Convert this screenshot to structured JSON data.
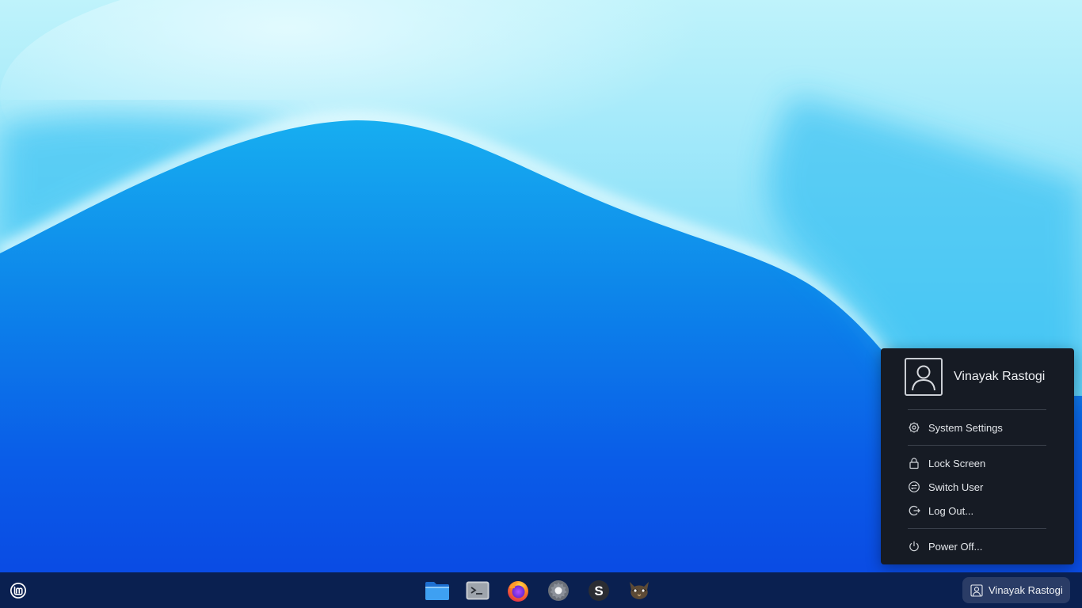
{
  "desktop": {
    "accent": "#0a52e8"
  },
  "user_menu": {
    "username": "Vinayak Rastogi",
    "avatar_icon": "user-avatar-icon",
    "items": [
      {
        "label": "System Settings",
        "icon": "gear-icon"
      },
      {
        "label": "Lock Screen",
        "icon": "lock-icon"
      },
      {
        "label": "Switch User",
        "icon": "switch-user-icon"
      },
      {
        "label": "Log Out...",
        "icon": "logout-icon"
      },
      {
        "label": "Power Off...",
        "icon": "power-icon"
      }
    ]
  },
  "panel": {
    "menu_icon": "mint-logo-icon",
    "launchers": [
      {
        "name": "Files",
        "icon": "folder-icon"
      },
      {
        "name": "Terminal",
        "icon": "terminal-icon"
      },
      {
        "name": "Firefox",
        "icon": "firefox-icon"
      },
      {
        "name": "System Settings",
        "icon": "settings-icon"
      },
      {
        "name": "S",
        "icon": "s-app-icon",
        "glyph": "S"
      },
      {
        "name": "GIMP",
        "icon": "gimp-icon"
      }
    ],
    "user_applet_label": "Vinayak Rastogi",
    "user_applet_icon": "user-icon"
  }
}
